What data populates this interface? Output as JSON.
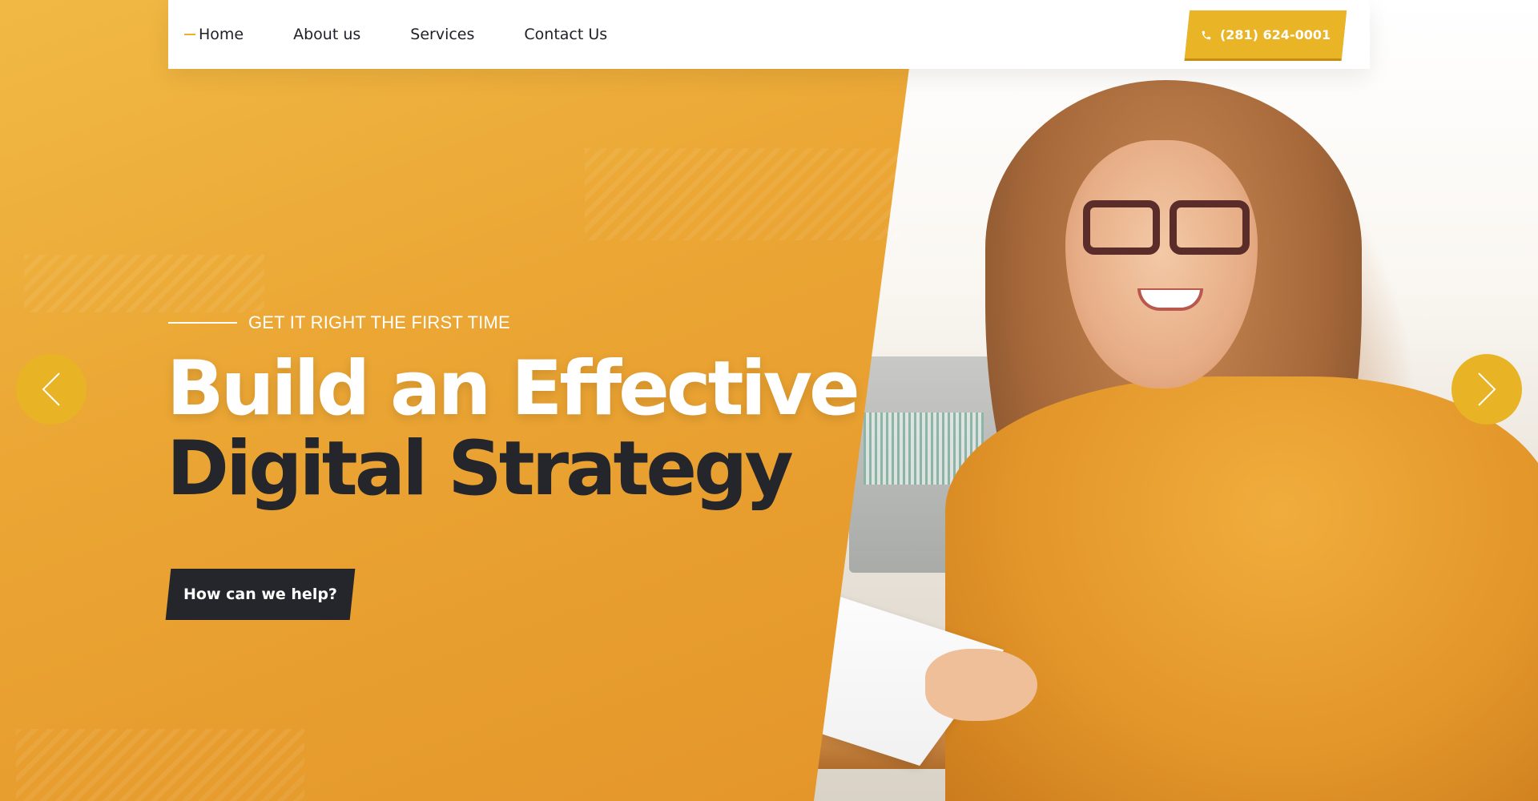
{
  "nav": {
    "items": [
      {
        "label": "Home",
        "active": true
      },
      {
        "label": "About us",
        "active": false
      },
      {
        "label": "Services",
        "active": false
      },
      {
        "label": "Contact Us",
        "active": false
      }
    ],
    "phone": "(281) 624-0001"
  },
  "hero": {
    "eyebrow": "GET IT RIGHT THE FIRST TIME",
    "headline_line1": "Build an Effective",
    "headline_line2": "Digital Strategy",
    "cta_label": "How can we help?"
  },
  "slider": {
    "prev_icon": "chevron-left-icon",
    "next_icon": "chevron-right-icon"
  },
  "colors": {
    "accent": "#e9b425",
    "orange_panel": "#e69a2c",
    "dark": "#24262c",
    "white": "#ffffff"
  }
}
